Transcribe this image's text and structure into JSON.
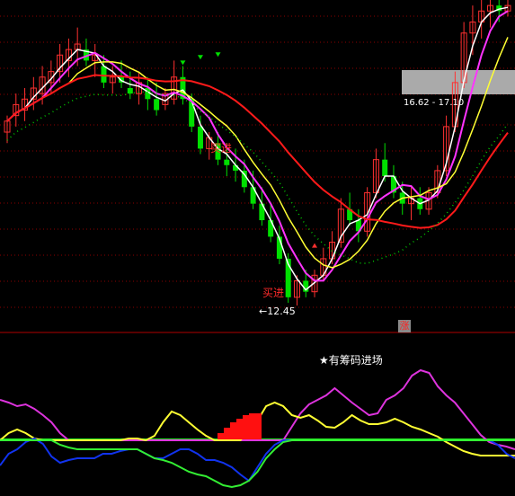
{
  "colors": {
    "background": "#000000",
    "up_candle": "#ff3030",
    "down_candle": "#00e000",
    "white_line": "#ffffff",
    "yellow_line": "#ffff33",
    "magenta_line": "#ff33ff",
    "red_line": "#ff1a1a",
    "dotted_line": "#00cc00",
    "grid": "#8b0000",
    "osc_magenta": "#dd33dd",
    "osc_yellow": "#ffff33",
    "osc_blue": "#1133ee",
    "osc_green": "#33ee33",
    "osc_baseline": "#22ee22",
    "osc_bars": "#ff1010"
  },
  "annotations": {
    "low_price": "12.45",
    "range_label": "16.62 - 17.10",
    "zhang": "涨",
    "star_note": "★有筹码进场",
    "buy_signal": "买进"
  },
  "chart_data": [
    {
      "type": "candlestick",
      "ylim": [
        11.8,
        18.0
      ],
      "grid": true,
      "annotations_text": [
        "12.45",
        "16.62 - 17.10",
        "买进"
      ],
      "candles": [
        [
          15.6,
          15.9,
          15.4,
          15.8
        ],
        [
          15.9,
          16.3,
          15.7,
          16.1
        ],
        [
          16.0,
          16.4,
          15.8,
          16.2
        ],
        [
          16.2,
          16.6,
          16.0,
          16.4
        ],
        [
          16.3,
          16.8,
          16.1,
          16.6
        ],
        [
          16.5,
          16.9,
          16.3,
          16.7
        ],
        [
          16.7,
          17.2,
          16.5,
          17.0
        ],
        [
          16.9,
          17.3,
          16.6,
          17.1
        ],
        [
          17.1,
          17.5,
          16.8,
          17.2
        ],
        [
          17.1,
          17.3,
          16.8,
          16.9
        ],
        [
          16.9,
          17.2,
          16.6,
          17.0
        ],
        [
          16.8,
          17.0,
          16.4,
          16.5
        ],
        [
          16.5,
          16.8,
          16.3,
          16.6
        ],
        [
          16.6,
          16.9,
          16.4,
          16.5
        ],
        [
          16.4,
          16.7,
          16.2,
          16.3
        ],
        [
          16.3,
          16.7,
          16.1,
          16.5
        ],
        [
          16.4,
          16.6,
          16.0,
          16.2
        ],
        [
          16.2,
          16.5,
          15.9,
          16.0
        ],
        [
          16.1,
          16.4,
          16.0,
          16.3
        ],
        [
          16.2,
          16.9,
          16.1,
          16.6
        ],
        [
          16.6,
          16.8,
          16.1,
          16.2
        ],
        [
          16.2,
          16.3,
          15.6,
          15.7
        ],
        [
          15.7,
          15.9,
          15.2,
          15.3
        ],
        [
          15.3,
          15.6,
          15.1,
          15.5
        ],
        [
          15.4,
          15.6,
          15.0,
          15.1
        ],
        [
          15.1,
          15.4,
          14.8,
          15.0
        ],
        [
          15.0,
          15.3,
          14.7,
          14.9
        ],
        [
          14.9,
          15.1,
          14.5,
          14.6
        ],
        [
          14.6,
          14.9,
          14.2,
          14.3
        ],
        [
          14.3,
          14.6,
          13.9,
          14.0
        ],
        [
          14.0,
          14.3,
          13.6,
          13.7
        ],
        [
          13.7,
          13.9,
          13.2,
          13.3
        ],
        [
          13.3,
          13.4,
          12.5,
          12.6
        ],
        [
          12.6,
          13.0,
          12.45,
          12.9
        ],
        [
          12.9,
          13.1,
          12.6,
          12.7
        ],
        [
          12.7,
          13.1,
          12.6,
          13.0
        ],
        [
          13.0,
          13.5,
          12.9,
          13.3
        ],
        [
          13.3,
          13.8,
          13.2,
          13.6
        ],
        [
          13.6,
          14.4,
          13.5,
          14.2
        ],
        [
          14.2,
          14.5,
          13.9,
          14.0
        ],
        [
          14.0,
          14.2,
          13.6,
          13.8
        ],
        [
          13.8,
          14.6,
          13.7,
          14.5
        ],
        [
          14.5,
          15.3,
          14.4,
          15.1
        ],
        [
          15.1,
          15.4,
          14.7,
          14.8
        ],
        [
          14.8,
          15.0,
          14.4,
          14.5
        ],
        [
          14.5,
          14.7,
          14.1,
          14.3
        ],
        [
          14.3,
          14.6,
          14.0,
          14.4
        ],
        [
          14.4,
          14.6,
          14.1,
          14.2
        ],
        [
          14.2,
          14.6,
          14.1,
          14.5
        ],
        [
          14.5,
          15.0,
          14.4,
          14.9
        ],
        [
          14.9,
          15.9,
          14.8,
          15.7
        ],
        [
          15.7,
          16.7,
          15.6,
          16.5
        ],
        [
          16.5,
          17.6,
          16.4,
          17.4
        ],
        [
          17.4,
          17.9,
          17.0,
          17.6
        ],
        [
          17.6,
          18.0,
          17.3,
          17.8
        ],
        [
          17.8,
          18.0,
          17.5,
          17.9
        ],
        [
          17.9,
          18.0,
          17.6,
          17.8
        ],
        [
          17.8,
          18.0,
          17.7,
          17.9
        ]
      ]
    },
    {
      "type": "line",
      "ylim": [
        -1,
        1
      ],
      "series_count": 4
    }
  ]
}
